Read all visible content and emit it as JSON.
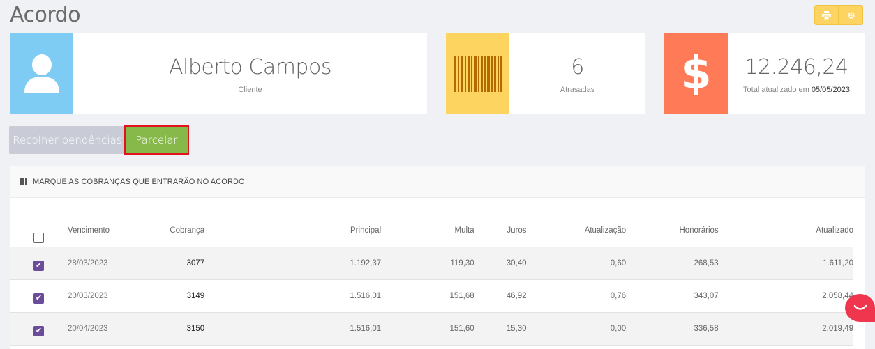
{
  "page": {
    "title": "Acordo"
  },
  "toolbar": {
    "print_icon": "print-icon",
    "settings_icon": "gear-icon"
  },
  "cards": {
    "client": {
      "value": "Alberto Campos",
      "label": "Cliente",
      "icon": "user-icon"
    },
    "late": {
      "value": "6",
      "label": "Atrasadas",
      "icon": "barcode-icon"
    },
    "total": {
      "value": "12.246,24",
      "label_prefix": "Total atualizado em",
      "date": "05/05/2023",
      "icon": "dollar-icon"
    }
  },
  "actions": {
    "collect_label": "Recolher pendências",
    "split_label": "Parcelar"
  },
  "panel": {
    "title": "MARQUE AS COBRANÇAS QUE ENTRARÃO NO ACORDO",
    "columns": [
      "Vencimento",
      "Cobrança",
      "Principal",
      "Multa",
      "Juros",
      "Atualização",
      "Honorários",
      "Atualizado"
    ],
    "rows": [
      {
        "vencimento": "28/03/2023",
        "cobranca": "3077",
        "principal": "1.192,37",
        "multa": "119,30",
        "juros": "30,40",
        "atualizacao": "0,60",
        "honorarios": "268,53",
        "atualizado": "1.611,20"
      },
      {
        "vencimento": "20/03/2023",
        "cobranca": "3149",
        "principal": "1.516,01",
        "multa": "151,68",
        "juros": "46,92",
        "atualizacao": "0,76",
        "honorarios": "343,07",
        "atualizado": "2.058,44"
      },
      {
        "vencimento": "20/04/2023",
        "cobranca": "3150",
        "principal": "1.516,01",
        "multa": "151,60",
        "juros": "15,30",
        "atualizacao": "0,00",
        "honorarios": "336,58",
        "atualizado": "2.019,49"
      }
    ]
  },
  "colors": {
    "client": "#7ecbf3",
    "late": "#fdd45f",
    "total": "#ff7a57",
    "split": "#86b94a",
    "checkbox": "#6b4c9a",
    "chat": "#f0354e"
  }
}
